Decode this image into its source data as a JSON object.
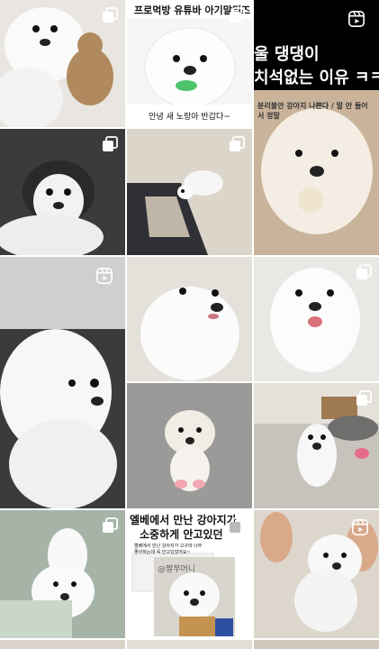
{
  "posts": [
    {
      "id": "p1",
      "type": "multi",
      "alt_label": ""
    },
    {
      "id": "p2",
      "type": "multi",
      "top_banner": "프로먹방 유튜바 아기말티즈",
      "bottom_caption": "안녕 새 노랑아 반갑다~"
    },
    {
      "id": "p3",
      "type": "reel",
      "line1": "울 댕댕이",
      "line2": "치석없는 이유 ㅋㅋㅋ",
      "subline": "분리불안 강아지 나쁜다 / 말 안 들어서 정말"
    },
    {
      "id": "p4",
      "type": "multi"
    },
    {
      "id": "p5",
      "type": "multi"
    },
    {
      "id": "p6",
      "type": "reel"
    },
    {
      "id": "p7",
      "type": "none"
    },
    {
      "id": "p8",
      "type": "multi"
    },
    {
      "id": "p9",
      "type": "multi"
    },
    {
      "id": "p10",
      "type": "none"
    },
    {
      "id": "p11",
      "type": "multi"
    },
    {
      "id": "p12",
      "type": "none"
    },
    {
      "id": "p13",
      "type": "multi",
      "title1": "엘베에서 만난 강아지가",
      "title2": "소중하게 안고있던",
      "screenshot_text": "엘베에서 만난 강아지가 고구마 너무 좋아하는데 꼭 안고있었어요~",
      "handle": "@짤쭈머니"
    },
    {
      "id": "p14",
      "type": "reel"
    }
  ],
  "icons": {
    "reel_badge": "reels-icon",
    "multi_badge": "carousel-icon"
  }
}
